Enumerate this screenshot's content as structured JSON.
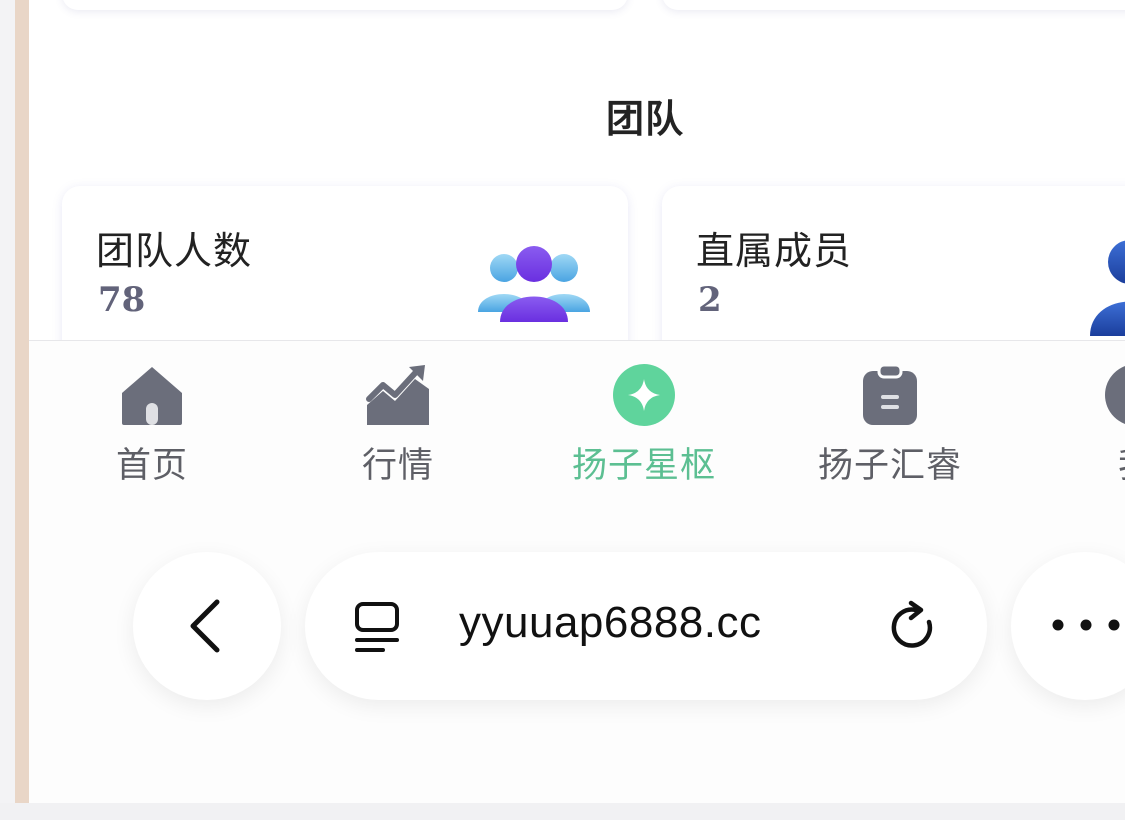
{
  "team_section": {
    "title": "团队",
    "cards": [
      {
        "label": "团队人数",
        "value": "78",
        "icon": "team-group-icon"
      },
      {
        "label": "直属成员",
        "value": "2",
        "icon": "member-icon"
      }
    ]
  },
  "tabbar": {
    "active_index": 2,
    "active_color": "#5cbf92",
    "items": [
      {
        "label": "首页",
        "icon": "home-icon"
      },
      {
        "label": "行情",
        "icon": "market-chart-icon"
      },
      {
        "label": "扬子星枢",
        "icon": "star-hub-icon"
      },
      {
        "label": "扬子汇睿",
        "icon": "clipboard-icon"
      },
      {
        "label": "我",
        "icon": "profile-icon"
      }
    ]
  },
  "browser": {
    "url": "yyuuap6888.cc",
    "back_icon": "chevron-left-icon",
    "page_icon": "page-summary-icon",
    "reload_icon": "reload-icon",
    "more_icon": "more-dots-icon"
  }
}
